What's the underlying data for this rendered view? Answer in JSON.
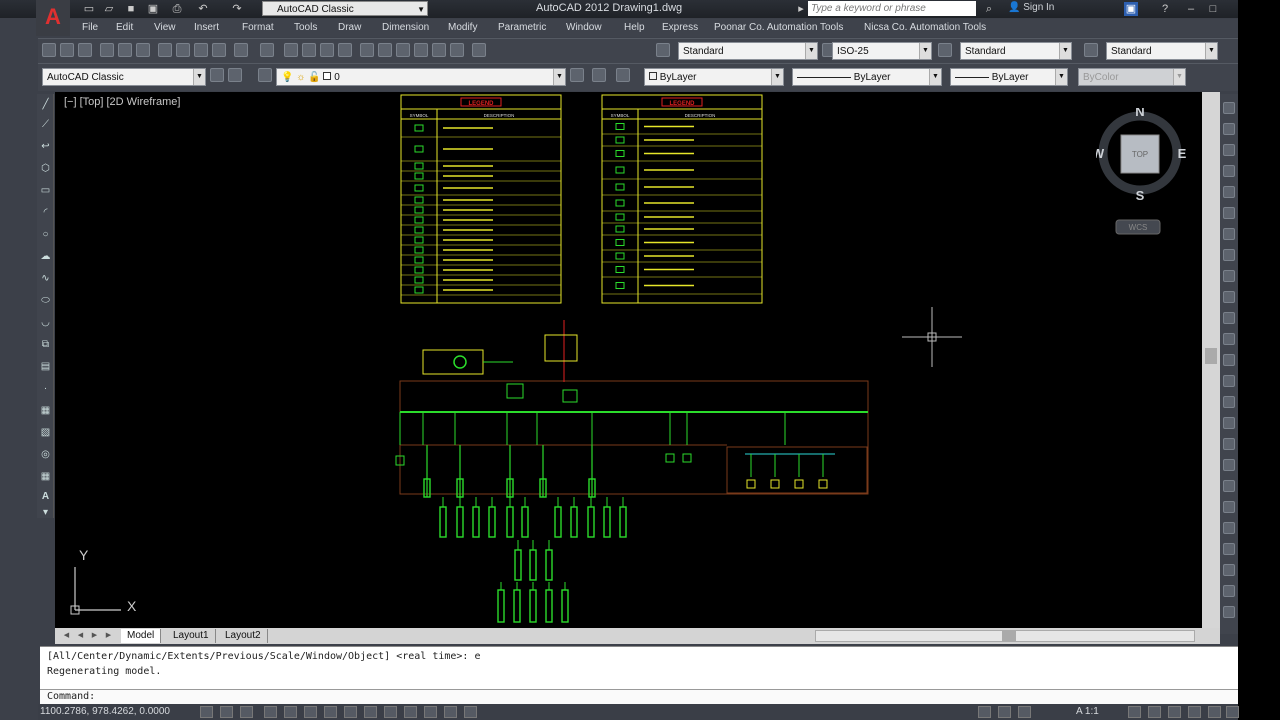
{
  "titlebar": {
    "logo": "A",
    "workspace": "AutoCAD Classic",
    "title": "AutoCAD 2012   Drawing1.dwg",
    "search_placeholder": "Type a keyword or phrase",
    "signin": "Sign In"
  },
  "menu": [
    "File",
    "Edit",
    "View",
    "Insert",
    "Format",
    "Tools",
    "Draw",
    "Dimension",
    "Modify",
    "Parametric",
    "Window",
    "Help",
    "Express",
    "Poonar Co. Automation Tools",
    "Nicsa Co. Automation Tools"
  ],
  "styles": {
    "text_style": "Standard",
    "dim_style": "ISO-25",
    "table_style": "Standard",
    "multileader_style": "Standard"
  },
  "layers": {
    "workspace": "AutoCAD Classic",
    "layer": "0",
    "color": "ByLayer",
    "linetype": "ByLayer",
    "lineweight": "ByLayer",
    "plotstyle": "ByColor"
  },
  "viewport": {
    "label": "[−] [Top] [2D Wireframe]",
    "ucs_x": "X",
    "ucs_y": "Y"
  },
  "viewcube": {
    "north": "N",
    "south": "S",
    "east": "E",
    "west": "W",
    "face": "TOP",
    "wcs": "WCS"
  },
  "legend_title": "LEGEND",
  "legend_headers": {
    "symbol": "SYMBOL",
    "description": "DESCRIPTION"
  },
  "tabs": [
    "Model",
    "Layout1",
    "Layout2"
  ],
  "command": {
    "line1": "[All/Center/Dynamic/Extents/Previous/Scale/Window/Object] <real time>: e",
    "line2": "Regenerating model.",
    "prompt": "Command:"
  },
  "status": {
    "coords": "1100.2786, 978.4262, 0.0000",
    "annoscale": "A 1:1"
  },
  "colors": {
    "drawing_green": "#2bdc2b",
    "drawing_yellow": "#e6e62a",
    "legend_red": "#e02020",
    "frame_brown": "#7a3a1a"
  }
}
